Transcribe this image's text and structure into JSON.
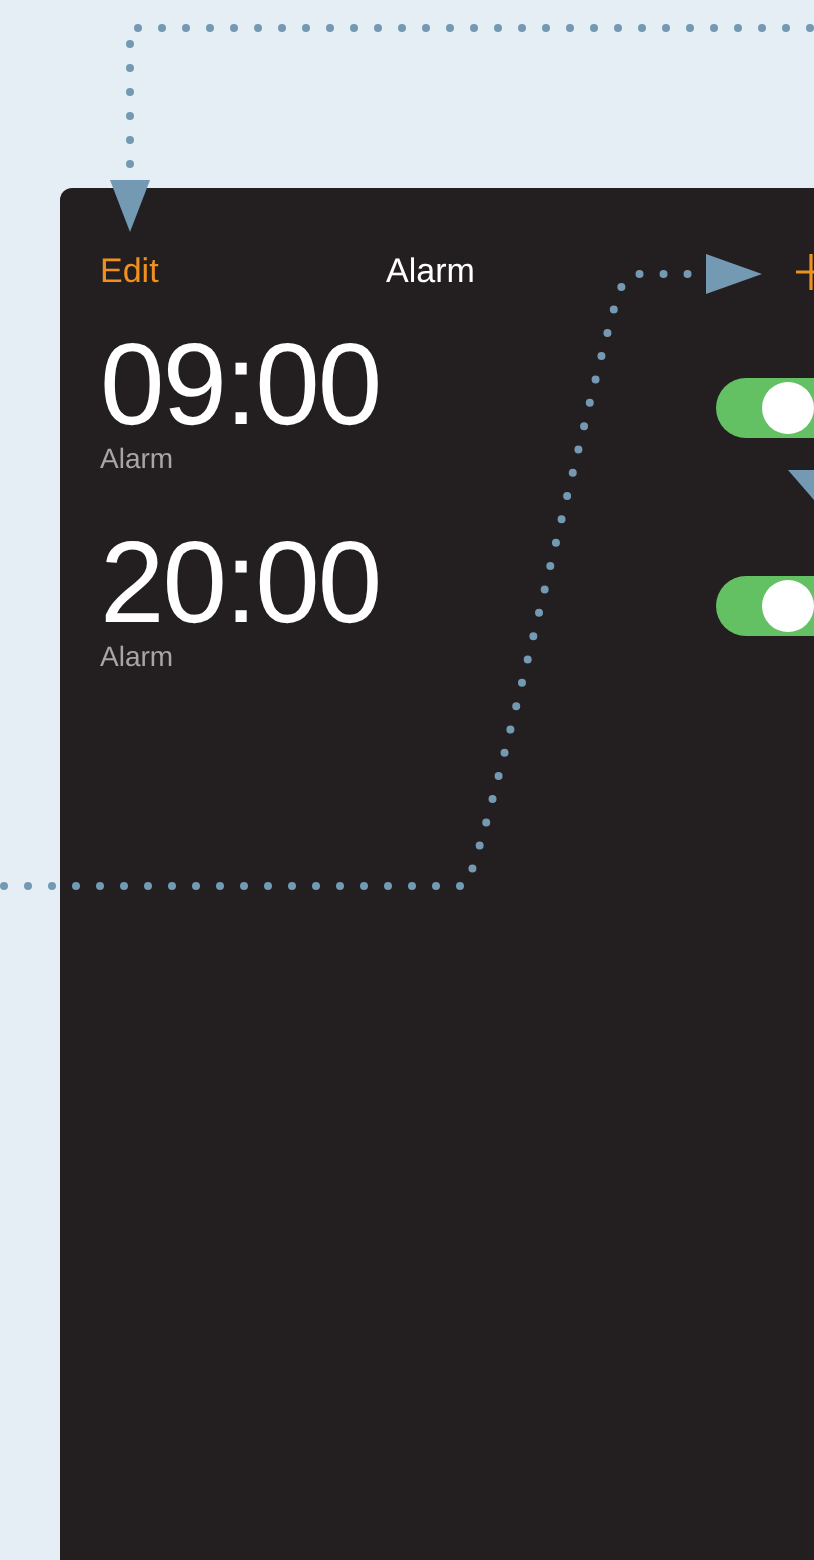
{
  "header": {
    "left_action": "Edit",
    "title": "Alarm"
  },
  "alarms": [
    {
      "time": "09:00",
      "label": "Alarm",
      "on": true
    },
    {
      "time": "20:00",
      "label": "Alarm",
      "on": true
    }
  ]
}
